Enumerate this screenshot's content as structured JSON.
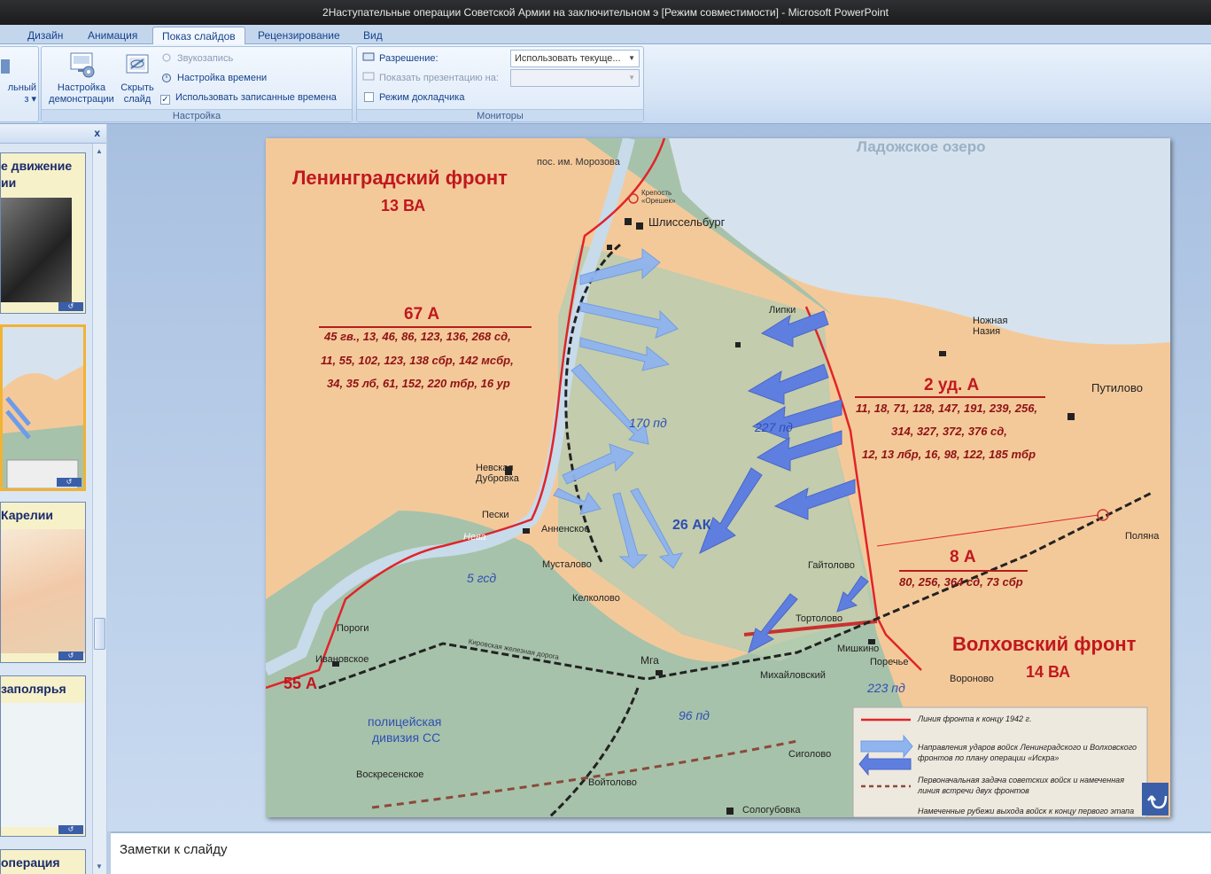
{
  "window": {
    "title": "2Наступательные операции Советской Армии на заключительном э [Режим совместимости] - Microsoft PowerPoint"
  },
  "tabs": [
    {
      "label": "Дизайн"
    },
    {
      "label": "Анимация"
    },
    {
      "label": "Показ слайдов",
      "active": true
    },
    {
      "label": "Рецензирование"
    },
    {
      "label": "Вид"
    }
  ],
  "ribbon": {
    "partial_group": {
      "line1": "льный",
      "line2": "з ▾"
    },
    "setup_group": {
      "label": "Настройка",
      "setup_show": "Настройка демонстрации",
      "hide_slide": "Скрыть слайд",
      "record_narration": "Звукозапись",
      "rehearse_timings": "Настройка времени",
      "use_timings": "Использовать записанные времена",
      "use_timings_checked": true
    },
    "monitors_group": {
      "label": "Мониторы",
      "resolution_label": "Разрешение:",
      "resolution_value": "Использовать текуще...",
      "show_on_label": "Показать презентацию на:",
      "show_on_value": "",
      "presenter_view": "Режим докладчика",
      "presenter_view_checked": false
    }
  },
  "slides_panel": {
    "close": "x",
    "thumbnails": [
      {
        "title_line1": "е движение",
        "title_line2": "ии"
      },
      {
        "title_line1": "",
        "selected": true
      },
      {
        "title_line1": "Карелии"
      },
      {
        "title_line1": "заполярья"
      },
      {
        "title_line1": "операция"
      }
    ]
  },
  "slide": {
    "map_labels": {
      "lake": "Ладожское озеро",
      "lenfront": "Ленинградский фронт",
      "lenfront_va": "13 ВА",
      "army67": "67 А",
      "army67_units": [
        "45 гв., 13, 46, 86, 123, 136, 268 сд,",
        "11, 55, 102, 123, 138 сбр, 142 мсбр,",
        "34, 35 лб, 61, 152, 220 тбр, 16 ур"
      ],
      "army2": "2 уд. А",
      "army2_units": [
        "11, 18, 71, 128, 147, 191, 239, 256,",
        "314, 327, 372, 376 сд,",
        "12, 13 лбр, 16, 98, 122, 185 тбр"
      ],
      "army8": "8 А",
      "army8_units": "80, 256, 364 сд, 73 сбр",
      "volfront": "Волховский фронт",
      "volfront_va": "14 ВА",
      "army55": "55 А",
      "pd170": "170 пд",
      "ak26": "26 АК",
      "gsd5": "5 гсд",
      "pd96": "96 пд",
      "pd223": "223 пд",
      "pd227": "227 пд",
      "ss_division": [
        "полицейская",
        "дивизия СС"
      ],
      "places": {
        "morozova": "пос. им. Морозова",
        "oreshek": "Крепость «Орешек»",
        "shlisselburg": "Шлиссельбург",
        "lipki": "Липки",
        "nazia": "Ножная Назия",
        "putilovo": "Путилово",
        "nevska": "Невская Дубровка",
        "peski": "Пески",
        "annenskoe": "Анненское",
        "neva": "Нева",
        "mustalovo": "Мусталово",
        "kelkolovo": "Келколово",
        "porogi": "Пороги",
        "ivanovskoe": "Ивановское",
        "mga": "Мга",
        "kirov_rr": "Кировская железная дорога",
        "gaitolovo": "Гайтолово",
        "tortolovo": "Тортолово",
        "mishkino": "Мишкино",
        "porechye": "Поречье",
        "mikhailovsky": "Михайловский",
        "voronovo": "Вороново",
        "polyana": "Поляна",
        "voskresenskoe": "Воскресенское",
        "voitolovo": "Войтолово",
        "sigolovo": "Сиголово",
        "sologubovka": "Сологубовка"
      }
    },
    "legend": [
      "Линия фронта к концу  1942 г.",
      "Направления ударов войск Ленинградского и Волховского фронтов по плану операции «Искра»",
      "Первоначальная задача советских войск и намеченная линия встречи двух фронтов",
      "Намеченные рубежи выхода войск к концу первого этапа"
    ]
  },
  "notes": {
    "placeholder": "Заметки к слайду"
  },
  "colors": {
    "front_line": "#e0242a",
    "arrow_fill": "#8fb4ee",
    "arrow_dark": "#5f7fe0",
    "lake": "#d6e3ee",
    "german_zone": "#a7c2aa",
    "soviet_zone": "#f4c99a"
  }
}
